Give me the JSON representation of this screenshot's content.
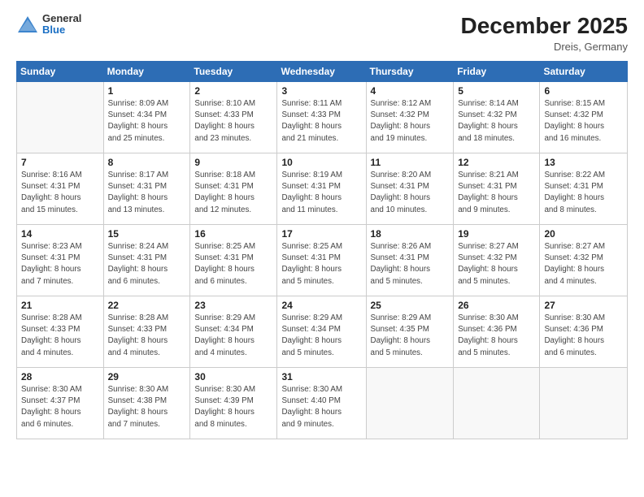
{
  "header": {
    "logo_general": "General",
    "logo_blue": "Blue",
    "month_title": "December 2025",
    "subtitle": "Dreis, Germany"
  },
  "calendar": {
    "days_of_week": [
      "Sunday",
      "Monday",
      "Tuesday",
      "Wednesday",
      "Thursday",
      "Friday",
      "Saturday"
    ],
    "weeks": [
      [
        {
          "day": "",
          "info": ""
        },
        {
          "day": "1",
          "info": "Sunrise: 8:09 AM\nSunset: 4:34 PM\nDaylight: 8 hours\nand 25 minutes."
        },
        {
          "day": "2",
          "info": "Sunrise: 8:10 AM\nSunset: 4:33 PM\nDaylight: 8 hours\nand 23 minutes."
        },
        {
          "day": "3",
          "info": "Sunrise: 8:11 AM\nSunset: 4:33 PM\nDaylight: 8 hours\nand 21 minutes."
        },
        {
          "day": "4",
          "info": "Sunrise: 8:12 AM\nSunset: 4:32 PM\nDaylight: 8 hours\nand 19 minutes."
        },
        {
          "day": "5",
          "info": "Sunrise: 8:14 AM\nSunset: 4:32 PM\nDaylight: 8 hours\nand 18 minutes."
        },
        {
          "day": "6",
          "info": "Sunrise: 8:15 AM\nSunset: 4:32 PM\nDaylight: 8 hours\nand 16 minutes."
        }
      ],
      [
        {
          "day": "7",
          "info": "Sunrise: 8:16 AM\nSunset: 4:31 PM\nDaylight: 8 hours\nand 15 minutes."
        },
        {
          "day": "8",
          "info": "Sunrise: 8:17 AM\nSunset: 4:31 PM\nDaylight: 8 hours\nand 13 minutes."
        },
        {
          "day": "9",
          "info": "Sunrise: 8:18 AM\nSunset: 4:31 PM\nDaylight: 8 hours\nand 12 minutes."
        },
        {
          "day": "10",
          "info": "Sunrise: 8:19 AM\nSunset: 4:31 PM\nDaylight: 8 hours\nand 11 minutes."
        },
        {
          "day": "11",
          "info": "Sunrise: 8:20 AM\nSunset: 4:31 PM\nDaylight: 8 hours\nand 10 minutes."
        },
        {
          "day": "12",
          "info": "Sunrise: 8:21 AM\nSunset: 4:31 PM\nDaylight: 8 hours\nand 9 minutes."
        },
        {
          "day": "13",
          "info": "Sunrise: 8:22 AM\nSunset: 4:31 PM\nDaylight: 8 hours\nand 8 minutes."
        }
      ],
      [
        {
          "day": "14",
          "info": "Sunrise: 8:23 AM\nSunset: 4:31 PM\nDaylight: 8 hours\nand 7 minutes."
        },
        {
          "day": "15",
          "info": "Sunrise: 8:24 AM\nSunset: 4:31 PM\nDaylight: 8 hours\nand 6 minutes."
        },
        {
          "day": "16",
          "info": "Sunrise: 8:25 AM\nSunset: 4:31 PM\nDaylight: 8 hours\nand 6 minutes."
        },
        {
          "day": "17",
          "info": "Sunrise: 8:25 AM\nSunset: 4:31 PM\nDaylight: 8 hours\nand 5 minutes."
        },
        {
          "day": "18",
          "info": "Sunrise: 8:26 AM\nSunset: 4:31 PM\nDaylight: 8 hours\nand 5 minutes."
        },
        {
          "day": "19",
          "info": "Sunrise: 8:27 AM\nSunset: 4:32 PM\nDaylight: 8 hours\nand 5 minutes."
        },
        {
          "day": "20",
          "info": "Sunrise: 8:27 AM\nSunset: 4:32 PM\nDaylight: 8 hours\nand 4 minutes."
        }
      ],
      [
        {
          "day": "21",
          "info": "Sunrise: 8:28 AM\nSunset: 4:33 PM\nDaylight: 8 hours\nand 4 minutes."
        },
        {
          "day": "22",
          "info": "Sunrise: 8:28 AM\nSunset: 4:33 PM\nDaylight: 8 hours\nand 4 minutes."
        },
        {
          "day": "23",
          "info": "Sunrise: 8:29 AM\nSunset: 4:34 PM\nDaylight: 8 hours\nand 4 minutes."
        },
        {
          "day": "24",
          "info": "Sunrise: 8:29 AM\nSunset: 4:34 PM\nDaylight: 8 hours\nand 5 minutes."
        },
        {
          "day": "25",
          "info": "Sunrise: 8:29 AM\nSunset: 4:35 PM\nDaylight: 8 hours\nand 5 minutes."
        },
        {
          "day": "26",
          "info": "Sunrise: 8:30 AM\nSunset: 4:36 PM\nDaylight: 8 hours\nand 5 minutes."
        },
        {
          "day": "27",
          "info": "Sunrise: 8:30 AM\nSunset: 4:36 PM\nDaylight: 8 hours\nand 6 minutes."
        }
      ],
      [
        {
          "day": "28",
          "info": "Sunrise: 8:30 AM\nSunset: 4:37 PM\nDaylight: 8 hours\nand 6 minutes."
        },
        {
          "day": "29",
          "info": "Sunrise: 8:30 AM\nSunset: 4:38 PM\nDaylight: 8 hours\nand 7 minutes."
        },
        {
          "day": "30",
          "info": "Sunrise: 8:30 AM\nSunset: 4:39 PM\nDaylight: 8 hours\nand 8 minutes."
        },
        {
          "day": "31",
          "info": "Sunrise: 8:30 AM\nSunset: 4:40 PM\nDaylight: 8 hours\nand 9 minutes."
        },
        {
          "day": "",
          "info": ""
        },
        {
          "day": "",
          "info": ""
        },
        {
          "day": "",
          "info": ""
        }
      ]
    ]
  }
}
